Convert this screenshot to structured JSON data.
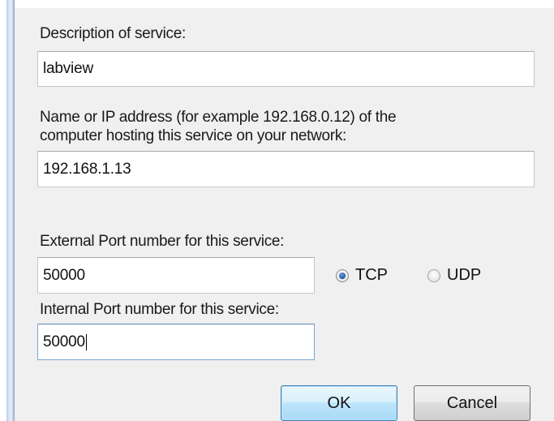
{
  "dialog": {
    "description_label": "Description of service:",
    "description_value": "labview",
    "host_label_line1": "Name or IP address (for example 192.168.0.12) of the",
    "host_label_line2": "computer hosting this service on your network:",
    "host_value": "192.168.1.13",
    "external_port_label": "External Port number for this service:",
    "external_port_value": "50000",
    "internal_port_label": "Internal Port number for this service:",
    "internal_port_value": "50000",
    "protocol": {
      "selected": "TCP",
      "options": [
        {
          "label": "TCP",
          "checked": true
        },
        {
          "label": "UDP",
          "checked": false
        }
      ]
    },
    "ok_label": "OK",
    "cancel_label": "Cancel"
  },
  "colors": {
    "dialog_background": "#f0f0f0",
    "default_button_border": "#3c7fb1",
    "radio_selected": "#2d5fa8"
  }
}
